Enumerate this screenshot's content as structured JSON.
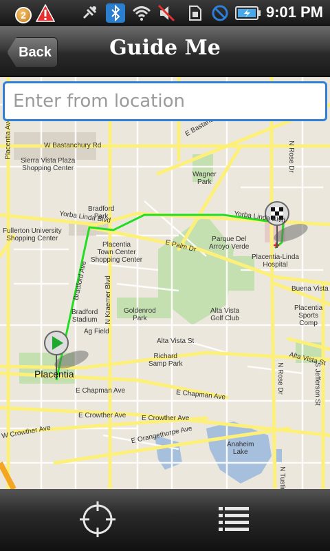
{
  "status_bar": {
    "notification_count": "2",
    "time": "9:01 PM"
  },
  "header": {
    "back_label": "Back",
    "title": "Guide Me"
  },
  "search": {
    "placeholder": "Enter from location",
    "value": ""
  },
  "map": {
    "labels": {
      "bastanchury": "W Bastanchury Rd",
      "sierra_vista": "Sierra Vista Plaza\nShopping Center",
      "wagner": "Wagner\nPark",
      "bradford_park": "Bradford\nPark",
      "fullerton": "Fullerton University\nShopping Center",
      "yorba_linda_w": "Yorba Linda Blvd",
      "yorba_linda_e": "Yorba Linda Blvd",
      "placentia_town": "Placentia\nTown Center\nShopping Center",
      "palm": "E Palm Dr",
      "parque": "Parque Del\nArroyo Verde",
      "hospital": "Placentia-Linda\nHospital",
      "bradford_stadium": "Bradford\nStadium",
      "goldenrod": "Goldenrod\nPark",
      "alta_vista_golf": "Alta Vista\nGolf Club",
      "buena_vista": "Buena Vista",
      "placentia_sports": "Placentia\nSports\nComp",
      "ag_field": "Ag Field",
      "alta_vista_st": "Alta Vista St",
      "alta_vista_st2": "Alta Vista St",
      "richard_samp": "Richard\nSamp Park",
      "placentia": "Placentia",
      "chapman1": "E Chapman Ave",
      "chapman2": "E Chapman Ave",
      "crowther1": "E Crowther Ave",
      "crowther2": "E Crowther Ave",
      "crowther3": "W Crowther Ave",
      "orangethorpe": "E Orangethorpe Ave",
      "anaheim_lake": "Anaheim\nLake",
      "rose_dr": "N Rose Dr",
      "rose_dr2": "N Rose Dr",
      "kraemer": "N Kraemer Blvd",
      "bradford_ave": "Bradford Ave",
      "placentia_ave": "Placentia Ave",
      "bastanchury_e": "E Bastanchury",
      "jefferson": "S Jefferson St",
      "tustin": "N Tustin"
    }
  },
  "bottom_bar": {
    "locate_icon": "crosshair-icon",
    "list_icon": "list-icon"
  },
  "colors": {
    "route": "#22dd22",
    "accent": "#2f7fd6",
    "road_major": "#fdf07a",
    "park": "#c4dfb0",
    "water": "#a5bfdd"
  }
}
